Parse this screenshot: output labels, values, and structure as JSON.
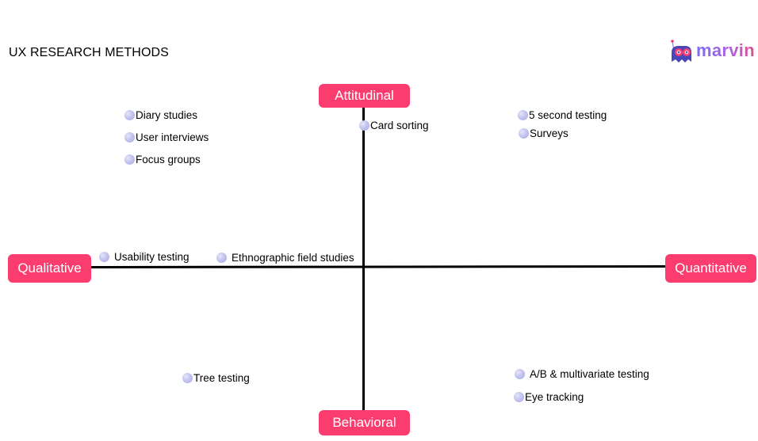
{
  "title": "UX RESEARCH METHODS",
  "logo": {
    "text": "marvin",
    "icon": "marvin-robot-logo-icon"
  },
  "colors": {
    "pill": "#fb3c6e",
    "dot": "#c4c4ef",
    "axis": "#000000"
  },
  "axes": {
    "top": "Attitudinal",
    "bottom": "Behavioral",
    "left": "Qualitative",
    "right": "Quantitative"
  },
  "methods": [
    {
      "label": "Diary studies",
      "quadrant": "attitudinal-qualitative"
    },
    {
      "label": "User interviews",
      "quadrant": "attitudinal-qualitative"
    },
    {
      "label": "Focus groups",
      "quadrant": "attitudinal-qualitative"
    },
    {
      "label": "Card sorting",
      "quadrant": "attitudinal-axis"
    },
    {
      "label": "5 second testing",
      "quadrant": "attitudinal-quantitative"
    },
    {
      "label": "Surveys",
      "quadrant": "attitudinal-quantitative"
    },
    {
      "label": "Usability testing",
      "quadrant": "qualitative-axis"
    },
    {
      "label": "Ethnographic field studies",
      "quadrant": "qualitative-axis"
    },
    {
      "label": "Tree testing",
      "quadrant": "behavioral-qualitative"
    },
    {
      "label": "A/B & multivariate testing",
      "quadrant": "behavioral-quantitative"
    },
    {
      "label": "Eye tracking",
      "quadrant": "behavioral-quantitative"
    }
  ]
}
